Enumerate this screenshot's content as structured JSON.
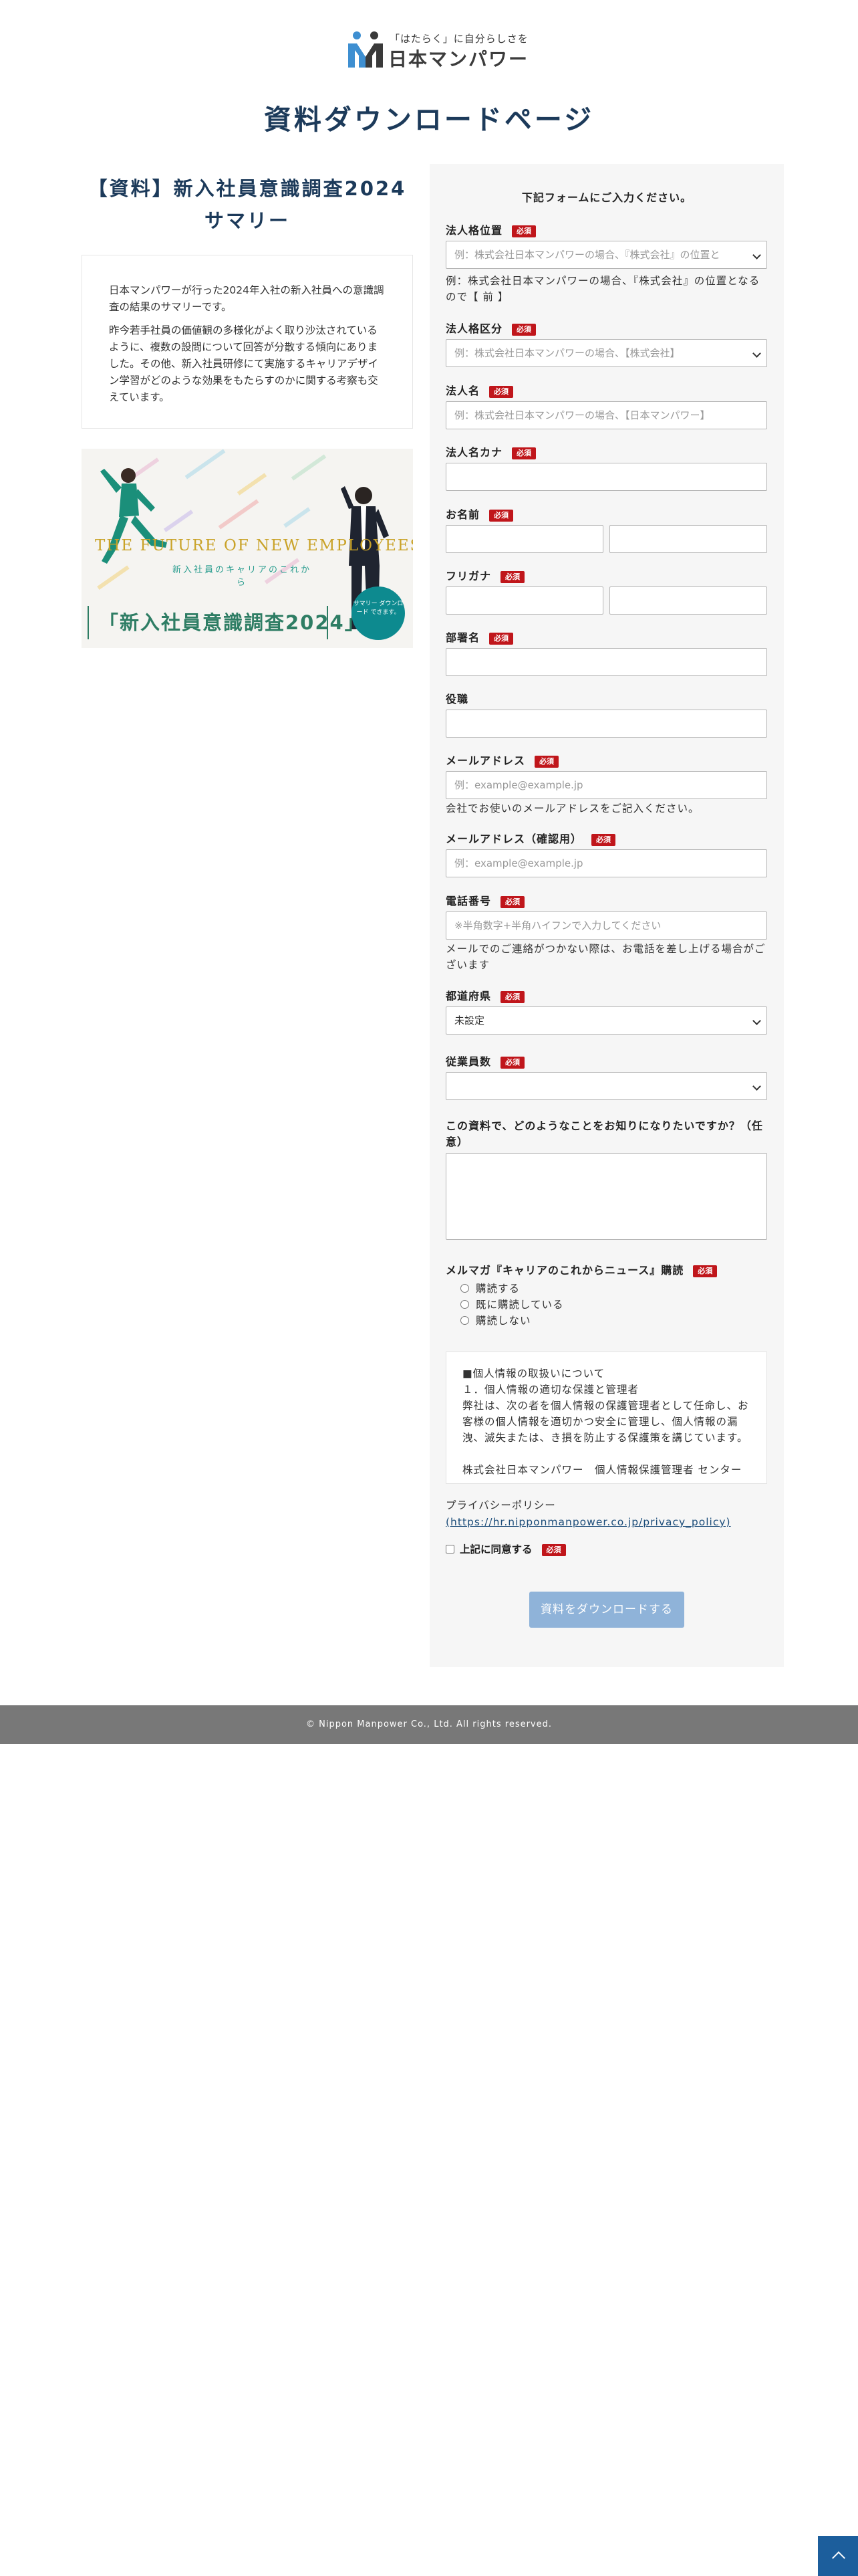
{
  "brand": {
    "tagline": "「はたらく」に自分らしさを",
    "name": "日本マンパワー",
    "accent": "#1c3a5a"
  },
  "page_title": "資料ダウンロードページ",
  "document": {
    "title_line1": "【資料】新入社員意識調査2024",
    "title_line2": "サマリー",
    "summary_p1": "日本マンパワーが行った2024年入社の新入社員への意識調査の結果のサマリーです。",
    "summary_p2": "昨今若手社員の価値観の多様化がよく取り沙汰されているように、複数の設問について回答が分散する傾向にありました。その他、新入社員研修にて実施するキャリアデザイン学習がどのような効果をもたらすのかに関する考察も交えています。",
    "hero_en": "THE FUTURE OF NEW EMPLOYEES' CAREERS",
    "hero_sub": "新入社員のキャリアのこれから",
    "hero_jp": "「新入社員意識調査2024」",
    "hero_badge": "サマリー ダウンロード できます。"
  },
  "form": {
    "intro": "下記フォームにご入力ください。",
    "required_label": "必須",
    "fields": {
      "legal_position": {
        "label": "法人格位置",
        "placeholder": "例：株式会社日本マンパワーの場合、『株式会社』の位置と",
        "note": "例：株式会社日本マンパワーの場合、『株式会社』の位置となるので【 前 】"
      },
      "legal_type": {
        "label": "法人格区分",
        "value": "例：株式会社日本マンパワーの場合、【株式会社】"
      },
      "company_name": {
        "label": "法人名",
        "placeholder": "例：株式会社日本マンパワーの場合、【日本マンパワー】"
      },
      "company_kana": {
        "label": "法人名カナ"
      },
      "name": {
        "label": "お名前"
      },
      "furigana": {
        "label": "フリガナ"
      },
      "department": {
        "label": "部署名"
      },
      "position": {
        "label": "役職"
      },
      "email": {
        "label": "メールアドレス",
        "placeholder": "例：example@example.jp",
        "note": "会社でお使いのメールアドレスをご記入ください。"
      },
      "email_confirm": {
        "label": "メールアドレス（確認用）",
        "placeholder": "例：example@example.jp"
      },
      "phone": {
        "label": "電話番号",
        "placeholder": "※半角数字+半角ハイフンで入力してください",
        "note": "メールでのご連絡がつかない際は、お電話を差し上げる場合がございます"
      },
      "prefecture": {
        "label": "都道府県",
        "value": "未設定"
      },
      "employees": {
        "label": "従業員数",
        "value": ""
      },
      "interest": {
        "label": "この資料で、どのようなことをお知りになりたいですか？（任意）"
      },
      "newsletter": {
        "label": "メルマガ『キャリアのこれからニュース』購読",
        "options": [
          "購読する",
          "既に購読している",
          "購読しない"
        ]
      }
    },
    "privacy": {
      "heading": "■個人情報の取扱いについて",
      "item1": "１．個人情報の適切な保護と管理者",
      "body": "弊社は、次の者を個人情報の保護管理者として任命し、お客様の個人情報を適切かつ安全に管理し、個人情報の漏洩、滅失または、き損を防止する保護策を講じています。",
      "cut_line": "株式会社日本マンパワー　個人情報保護管理者 センター",
      "policy_label": "プライバシーポリシー",
      "policy_link": "(https://hr.nipponmanpower.co.jp/privacy_policy)",
      "agree_label": "上記に同意する"
    },
    "submit": "資料をダウンロードする"
  },
  "footer": {
    "copyright": "© Nippon Manpower Co., Ltd. All rights reserved."
  }
}
